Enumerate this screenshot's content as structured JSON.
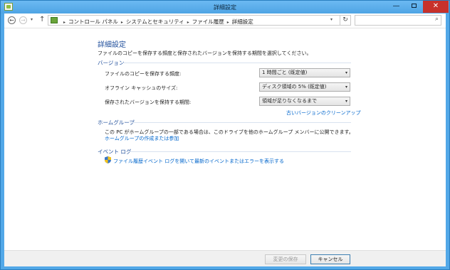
{
  "window": {
    "title": "詳細設定",
    "minimize_glyph": "—",
    "close_glyph": "✕"
  },
  "nav": {
    "back_glyph": "←",
    "forward_glyph": "→",
    "recent_glyph": "▾",
    "up_glyph": "↑",
    "breadcrumb": [
      "コントロール パネル",
      "システムとセキュリティ",
      "ファイル履歴",
      "詳細設定"
    ],
    "separator_glyph": "▸",
    "dropdown_glyph": "▾",
    "refresh_glyph": "↻",
    "search_placeholder": "",
    "search_glyph": "⌕"
  },
  "page": {
    "heading": "詳細設定",
    "description": "ファイルのコピーを保存する頻度と保存されたバージョンを保持する期間を選択してください。"
  },
  "versions": {
    "title": "バージョン",
    "rows": [
      {
        "label": "ファイルのコピーを保存する頻度:",
        "value": "1 時間ごと (既定値)"
      },
      {
        "label": "オフライン キャッシュのサイズ:",
        "value": "ディスク領域の 5% (既定値)"
      },
      {
        "label": "保存されたバージョンを保持する期間:",
        "value": "領域が足りなくなるまで"
      }
    ],
    "combo_arrow": "▾",
    "cleanup_link": "古いバージョンのクリーンアップ"
  },
  "homegroup": {
    "title": "ホームグループ",
    "text": "この PC がホームグループの一部である場合は、このドライブを他のホームグループ メンバーに公開できます。",
    "link": "ホームグループの作成または参加"
  },
  "eventlog": {
    "title": "イベント ログ",
    "link": "ファイル履歴イベント ログを開いて最新のイベントまたはエラーを表示する"
  },
  "footer": {
    "save_label": "変更の保存",
    "cancel_label": "キャンセル"
  },
  "colors": {
    "accent": "#1f4e9b",
    "link": "#0066cc",
    "close": "#c7312b",
    "titlebar": "#52a8e8"
  }
}
